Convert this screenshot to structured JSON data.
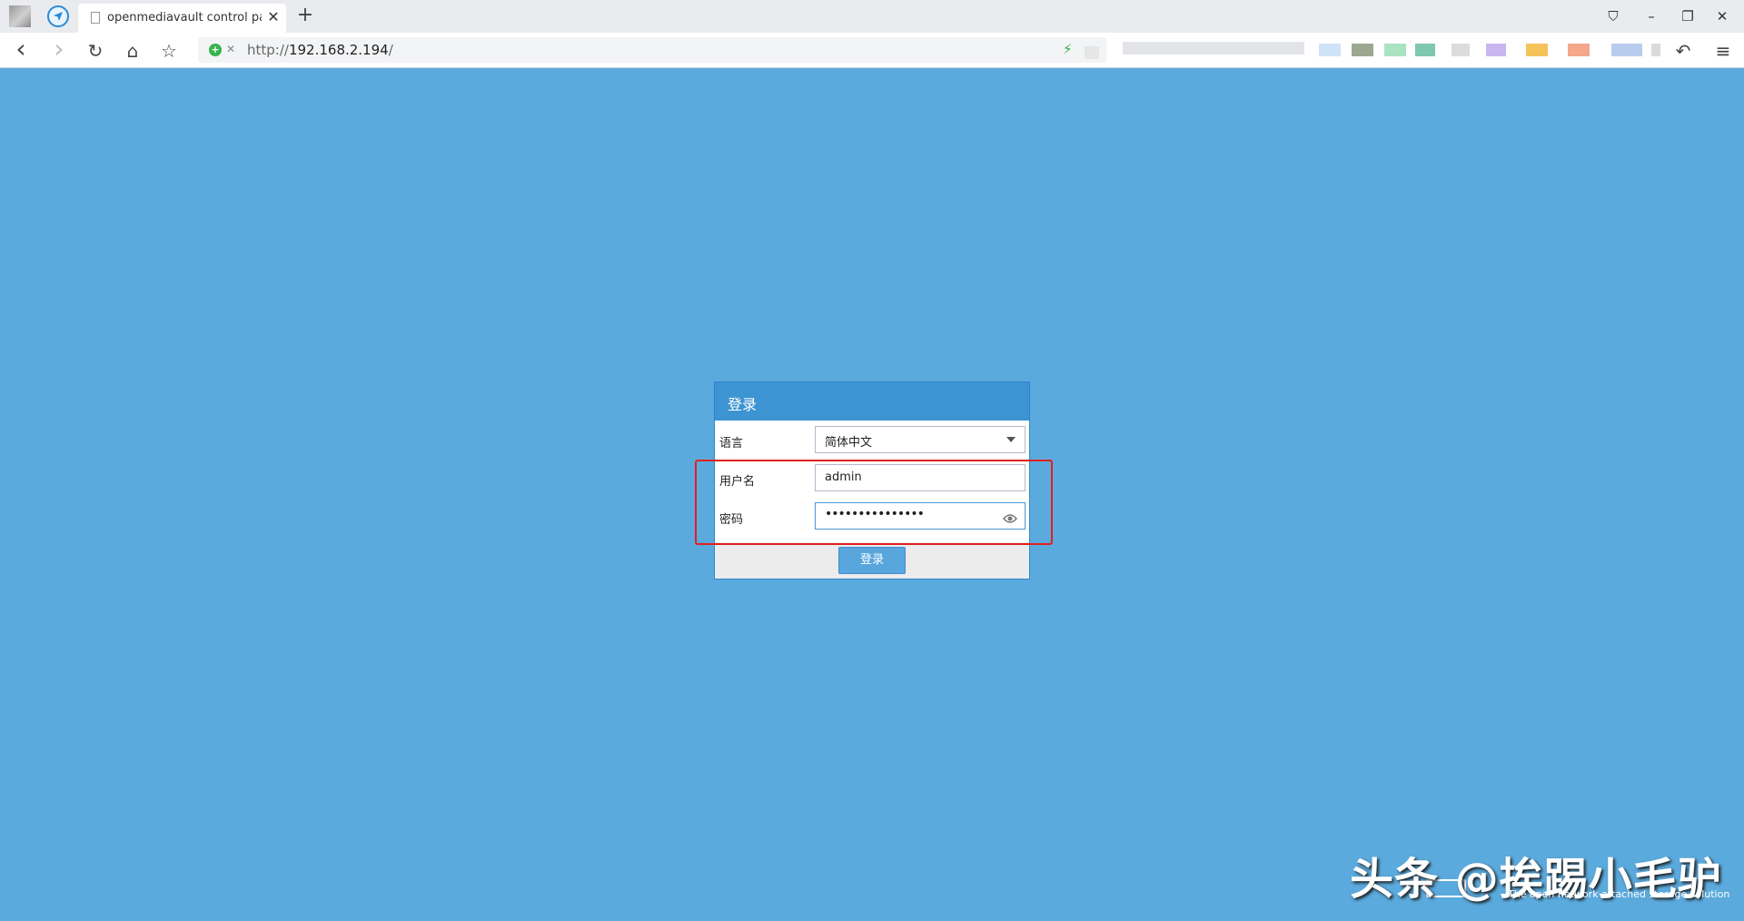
{
  "browser": {
    "tab_title": "openmediavault control panel",
    "tab_close": "✕",
    "new_tab": "+",
    "url_scheme": "http://",
    "url_host": "192.168.2.194",
    "url_path": "/",
    "window_buttons": {
      "pin": "⛉",
      "minimize": "–",
      "restore": "❐",
      "close": "✕"
    },
    "nav": {
      "back": "‹",
      "forward": "›",
      "reload": "↻",
      "home": "⌂",
      "bookmark": "☆",
      "undo": "↶",
      "menu": "≡"
    }
  },
  "login": {
    "title": "登录",
    "language_label": "语言",
    "language_value": "简体中文",
    "username_label": "用户名",
    "username_value": "admin",
    "password_label": "密码",
    "password_value": "•••••••••••••••",
    "submit_label": "登录"
  },
  "watermark": {
    "text": "头条 @挨踢小毛驴",
    "subtitle": "The open network attached storage solution"
  },
  "colors": {
    "page_bg": "#5baadd",
    "panel_header": "#3d94d2",
    "highlight_border": "#e02020",
    "button": "#58a6dd"
  }
}
